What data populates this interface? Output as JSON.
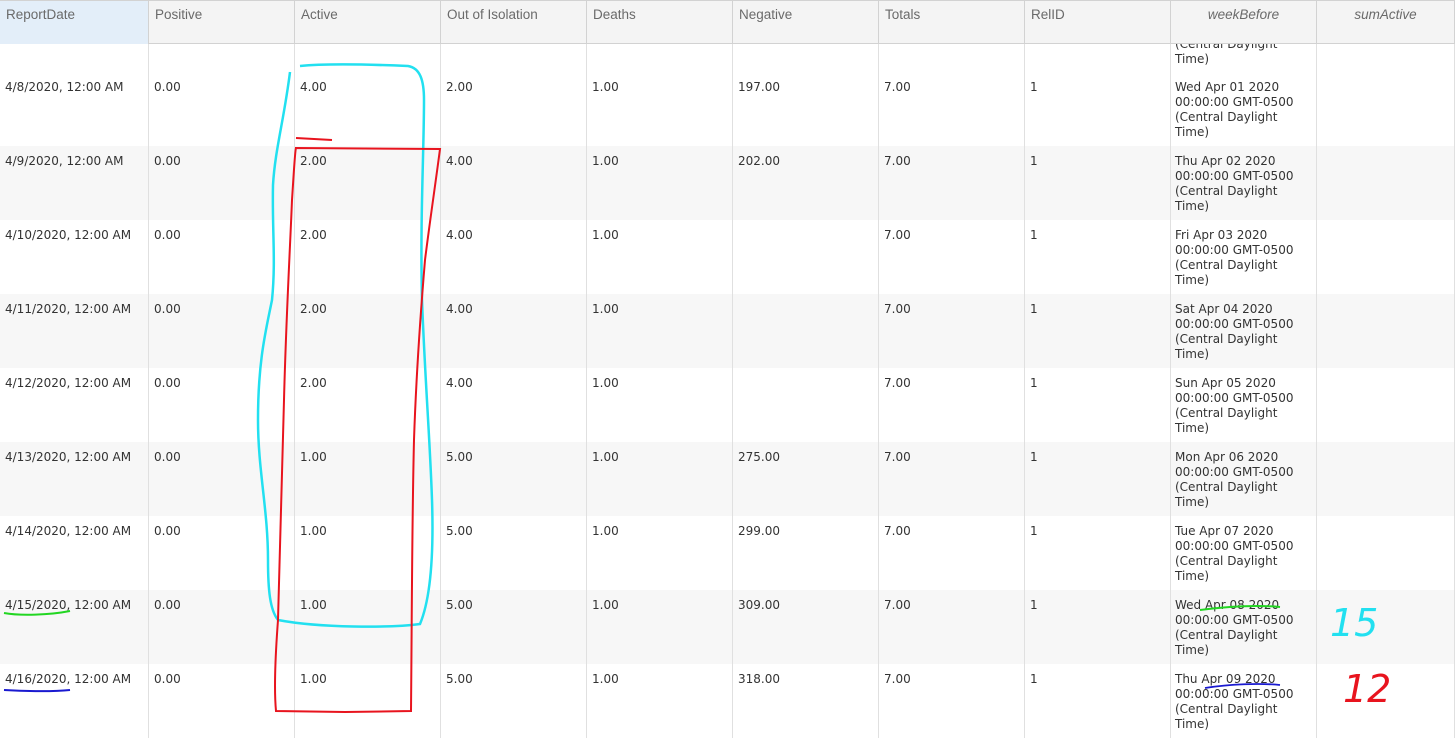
{
  "columns": [
    {
      "id": "ReportDate",
      "label": "ReportDate",
      "selected": true,
      "italic": false
    },
    {
      "id": "Positive",
      "label": "Positive",
      "selected": false,
      "italic": false
    },
    {
      "id": "Active",
      "label": "Active",
      "selected": false,
      "italic": false
    },
    {
      "id": "OutOfIsolation",
      "label": "Out of Isolation",
      "selected": false,
      "italic": false
    },
    {
      "id": "Deaths",
      "label": "Deaths",
      "selected": false,
      "italic": false
    },
    {
      "id": "Negative",
      "label": "Negative",
      "selected": false,
      "italic": false
    },
    {
      "id": "Totals",
      "label": "Totals",
      "selected": false,
      "italic": false
    },
    {
      "id": "RelID",
      "label": "RelID",
      "selected": false,
      "italic": false
    },
    {
      "id": "weekBefore",
      "label": "weekBefore",
      "selected": false,
      "italic": true
    },
    {
      "id": "sumActive",
      "label": "sumActive",
      "selected": false,
      "italic": true
    }
  ],
  "partial_row": {
    "weekBefore": "(Central Daylight\nTime)"
  },
  "rows": [
    {
      "ReportDate": "4/8/2020, 12:00 AM",
      "Positive": "0.00",
      "Active": "4.00",
      "OutOfIsolation": "2.00",
      "Deaths": "1.00",
      "Negative": "197.00",
      "Totals": "7.00",
      "RelID": "1",
      "weekBefore": "Wed Apr 01 2020\n00:00:00 GMT-0500\n(Central Daylight\nTime)",
      "sumActive": ""
    },
    {
      "ReportDate": "4/9/2020, 12:00 AM",
      "Positive": "0.00",
      "Active": "2.00",
      "OutOfIsolation": "4.00",
      "Deaths": "1.00",
      "Negative": "202.00",
      "Totals": "7.00",
      "RelID": "1",
      "weekBefore": "Thu Apr 02 2020\n00:00:00 GMT-0500\n(Central Daylight\nTime)",
      "sumActive": ""
    },
    {
      "ReportDate": "4/10/2020, 12:00 AM",
      "Positive": "0.00",
      "Active": "2.00",
      "OutOfIsolation": "4.00",
      "Deaths": "1.00",
      "Negative": "",
      "Totals": "7.00",
      "RelID": "1",
      "weekBefore": "Fri Apr 03 2020\n00:00:00 GMT-0500\n(Central Daylight\nTime)",
      "sumActive": ""
    },
    {
      "ReportDate": "4/11/2020, 12:00 AM",
      "Positive": "0.00",
      "Active": "2.00",
      "OutOfIsolation": "4.00",
      "Deaths": "1.00",
      "Negative": "",
      "Totals": "7.00",
      "RelID": "1",
      "weekBefore": "Sat Apr 04 2020\n00:00:00 GMT-0500\n(Central Daylight\nTime)",
      "sumActive": ""
    },
    {
      "ReportDate": "4/12/2020, 12:00 AM",
      "Positive": "0.00",
      "Active": "2.00",
      "OutOfIsolation": "4.00",
      "Deaths": "1.00",
      "Negative": "",
      "Totals": "7.00",
      "RelID": "1",
      "weekBefore": "Sun Apr 05 2020\n00:00:00 GMT-0500\n(Central Daylight\nTime)",
      "sumActive": ""
    },
    {
      "ReportDate": "4/13/2020, 12:00 AM",
      "Positive": "0.00",
      "Active": "1.00",
      "OutOfIsolation": "5.00",
      "Deaths": "1.00",
      "Negative": "275.00",
      "Totals": "7.00",
      "RelID": "1",
      "weekBefore": "Mon Apr 06 2020\n00:00:00 GMT-0500\n(Central Daylight\nTime)",
      "sumActive": ""
    },
    {
      "ReportDate": "4/14/2020, 12:00 AM",
      "Positive": "0.00",
      "Active": "1.00",
      "OutOfIsolation": "5.00",
      "Deaths": "1.00",
      "Negative": "299.00",
      "Totals": "7.00",
      "RelID": "1",
      "weekBefore": "Tue Apr 07 2020\n00:00:00 GMT-0500\n(Central Daylight\nTime)",
      "sumActive": ""
    },
    {
      "ReportDate": "4/15/2020, 12:00 AM",
      "Positive": "0.00",
      "Active": "1.00",
      "OutOfIsolation": "5.00",
      "Deaths": "1.00",
      "Negative": "309.00",
      "Totals": "7.00",
      "RelID": "1",
      "weekBefore": "Wed Apr 08 2020\n00:00:00 GMT-0500\n(Central Daylight\nTime)",
      "sumActive": ""
    },
    {
      "ReportDate": "4/16/2020, 12:00 AM",
      "Positive": "0.00",
      "Active": "1.00",
      "OutOfIsolation": "5.00",
      "Deaths": "1.00",
      "Negative": "318.00",
      "Totals": "7.00",
      "RelID": "1",
      "weekBefore": "Thu Apr 09 2020\n00:00:00 GMT-0500\n(Central Daylight\nTime)",
      "sumActive": ""
    }
  ],
  "annotations": {
    "cyan_color": "#22e0f0",
    "red_color": "#e8141e",
    "green_color": "#22d622",
    "blue_color": "#1a1ad0",
    "cyan_label": "15",
    "red_label": "12"
  }
}
